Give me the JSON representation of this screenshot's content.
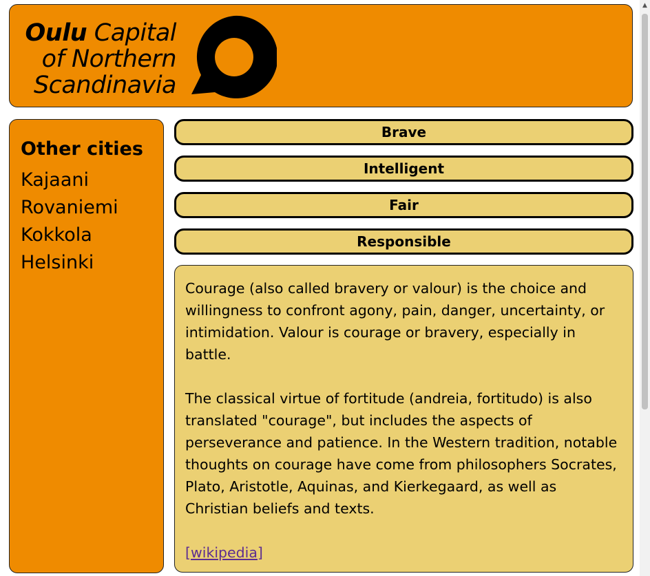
{
  "header": {
    "logo_bold": "Oulu",
    "logo_line1_rest": "Capital",
    "logo_line2": "of Northern",
    "logo_line3": "Scandinavia",
    "logo_icon": "speech-bubble-icon",
    "background_color": "#ef8b00"
  },
  "sidebar": {
    "title": "Other cities",
    "cities": [
      "Kajaani",
      "Rovaniemi",
      "Kokkola",
      "Helsinki"
    ]
  },
  "tabs": [
    "Brave",
    "Intelligent",
    "Fair",
    "Responsible"
  ],
  "content": {
    "paragraph1": "Courage (also called bravery or valour) is the choice and willingness to confront agony, pain, danger, uncertainty, or intimidation. Valour is courage or bravery, especially in battle.",
    "paragraph2": "The classical virtue of fortitude (andreia, fortitudo) is also translated \"courage\", but includes the aspects of perseverance and patience. In the Western tradition, notable thoughts on courage have come from philosophers Socrates, Plato, Aristotle, Aquinas, and Kierkegaard, as well as Christian beliefs and texts.",
    "link_label": "[wikipedia]",
    "background_color": "#ebd073"
  }
}
